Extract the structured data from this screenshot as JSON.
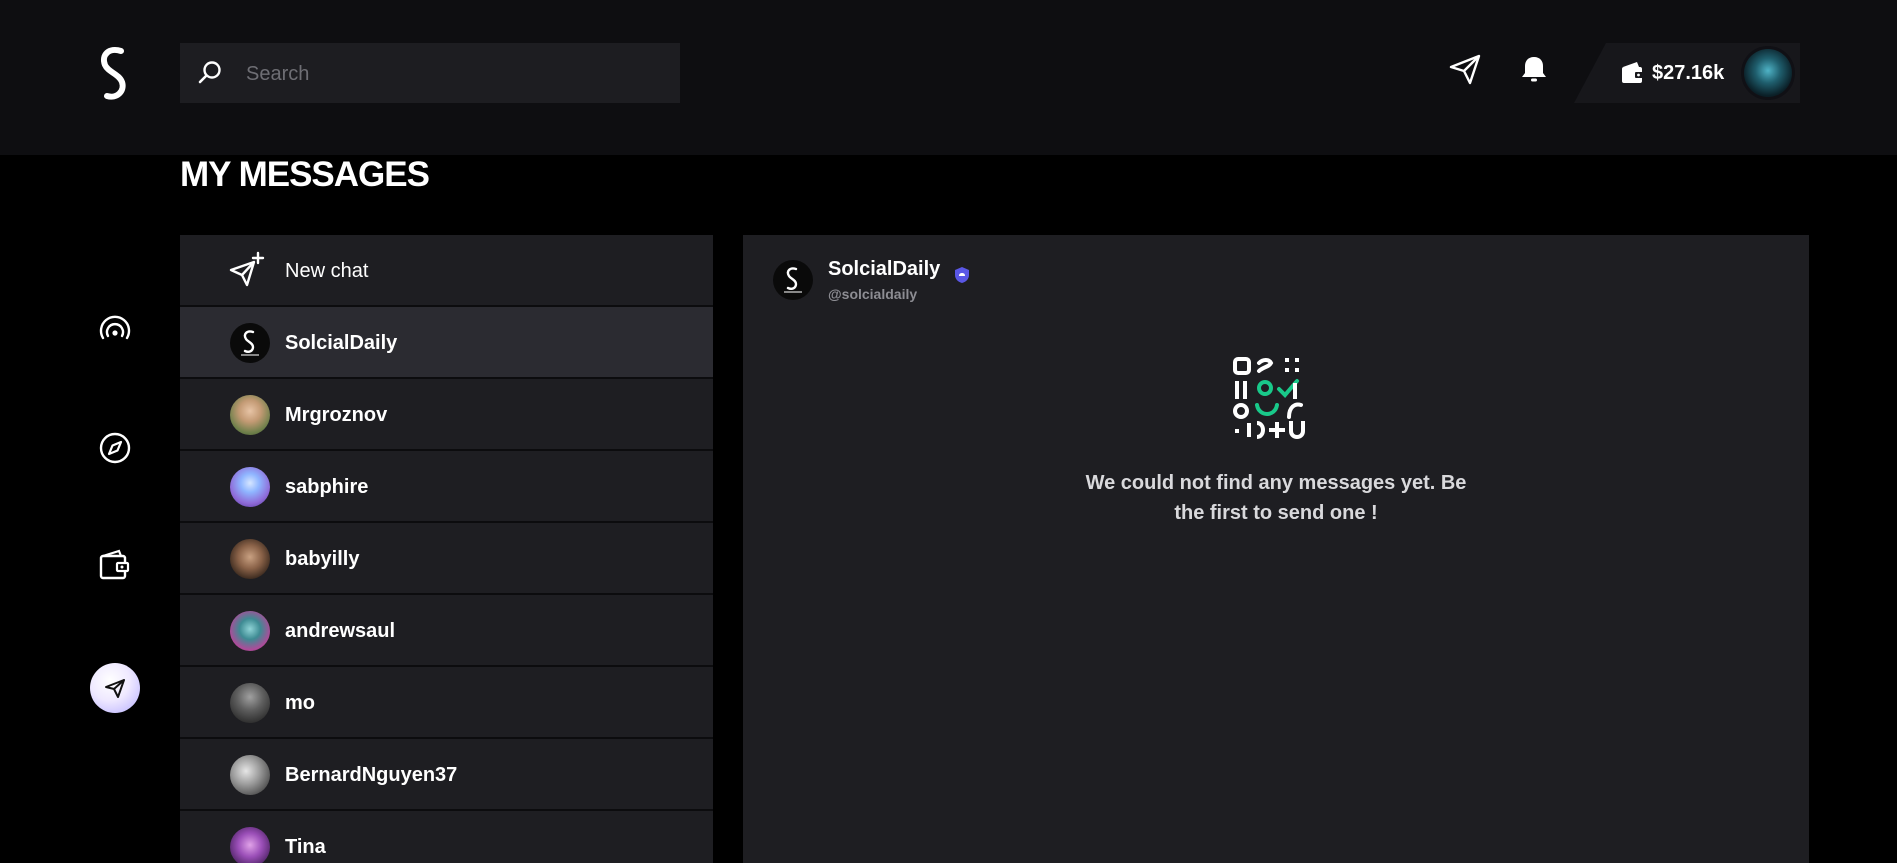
{
  "header": {
    "search": {
      "placeholder": "Search",
      "value": ""
    },
    "wallet_amount": "$27.16k",
    "icons": [
      "logo-icon",
      "search-icon",
      "send-icon",
      "bell-icon",
      "wallet-icon",
      "user-avatar"
    ]
  },
  "sidebar": {
    "items": [
      {
        "name": "broadcast-icon"
      },
      {
        "name": "compass-icon"
      },
      {
        "name": "wallet-icon"
      },
      {
        "name": "messages-icon",
        "active": true
      }
    ]
  },
  "page": {
    "title": "MY MESSAGES"
  },
  "chatlist": {
    "new_chat_label": "New chat",
    "items": [
      {
        "label": "SolcialDaily",
        "active": true
      },
      {
        "label": "Mrgroznov"
      },
      {
        "label": "sabphire"
      },
      {
        "label": "babyilly"
      },
      {
        "label": "andrewsaul"
      },
      {
        "label": "mo"
      },
      {
        "label": "BernardNguyen37"
      },
      {
        "label": "Tina"
      }
    ]
  },
  "conversation": {
    "name": "SolcialDaily",
    "handle": "@solcialdaily",
    "empty_message": "We could not find any messages yet. Be the first to send one !"
  },
  "colors": {
    "accent": "#19c98a",
    "verified": "#5a57e6",
    "panel": "#1e1e22",
    "active_row": "#2b2b31"
  }
}
